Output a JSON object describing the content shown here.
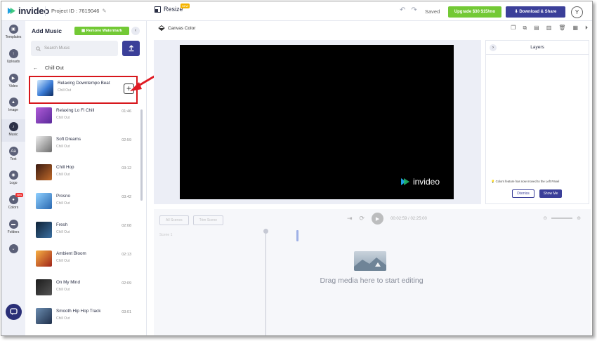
{
  "app": {
    "name": "invideo",
    "project_label": "Project ID : 7619046",
    "resize": "Resize",
    "resize_tag": "NEW",
    "saved": "Saved",
    "upgrade": "Upgrade $30 $15/mo",
    "download": "Download & Share",
    "avatar": "Y"
  },
  "rail": [
    {
      "label": "Templates",
      "icon": "templates-icon"
    },
    {
      "label": "Uploads",
      "icon": "upload-icon"
    },
    {
      "label": "Video",
      "icon": "video-icon"
    },
    {
      "label": "Image",
      "icon": "image-icon"
    },
    {
      "label": "Music",
      "icon": "music-icon",
      "active": true
    },
    {
      "label": "Text",
      "icon": "text-icon"
    },
    {
      "label": "Logo",
      "icon": "logo-icon"
    },
    {
      "label": "Colors",
      "icon": "colors-icon",
      "badge": "New"
    },
    {
      "label": "Folders",
      "icon": "folder-icon"
    }
  ],
  "panel": {
    "title": "Add Music",
    "remove_watermark": "Remove Watermark",
    "search_placeholder": "Search Music",
    "category": "Chill Out",
    "tracks": [
      {
        "name": "Relaxing Downtempo Beat",
        "category": "Chill Out",
        "duration": "",
        "selected": true
      },
      {
        "name": "Relaxing Lo Fi Chill",
        "category": "Chill Out",
        "duration": "01:46"
      },
      {
        "name": "Soft Dreams",
        "category": "Chill Out",
        "duration": "02:59"
      },
      {
        "name": "Chill Hop",
        "category": "Chill Out",
        "duration": "03:12"
      },
      {
        "name": "Prosno",
        "category": "Chill Out",
        "duration": "03:42"
      },
      {
        "name": "Fresh",
        "category": "Chill Out",
        "duration": "02:08"
      },
      {
        "name": "Ambient Bloom",
        "category": "Chill Out",
        "duration": "02:13"
      },
      {
        "name": "On My Mind",
        "category": "Chill Out",
        "duration": "02:09"
      },
      {
        "name": "Smooth Hip Hop Track",
        "category": "Chill Out",
        "duration": "03:01"
      }
    ]
  },
  "stage": {
    "canvas_color": "Canvas Color",
    "watermark": "invideo"
  },
  "layers": {
    "title": "Layers",
    "note": "Colors feature has now moved to the Left Panel",
    "dismiss": "Dismiss",
    "show_me": "Show Me"
  },
  "timeline": {
    "scenes_btn": "All Scenes",
    "trim_btn": "Trim Scene",
    "time": "00:02:59 / 02:25:00",
    "drop_text": "Drag media here to start editing",
    "scene_label": "Scene 1"
  },
  "colors": {
    "accent": "#3b3f99",
    "green": "#73c935",
    "highlight": "#d7161b"
  }
}
